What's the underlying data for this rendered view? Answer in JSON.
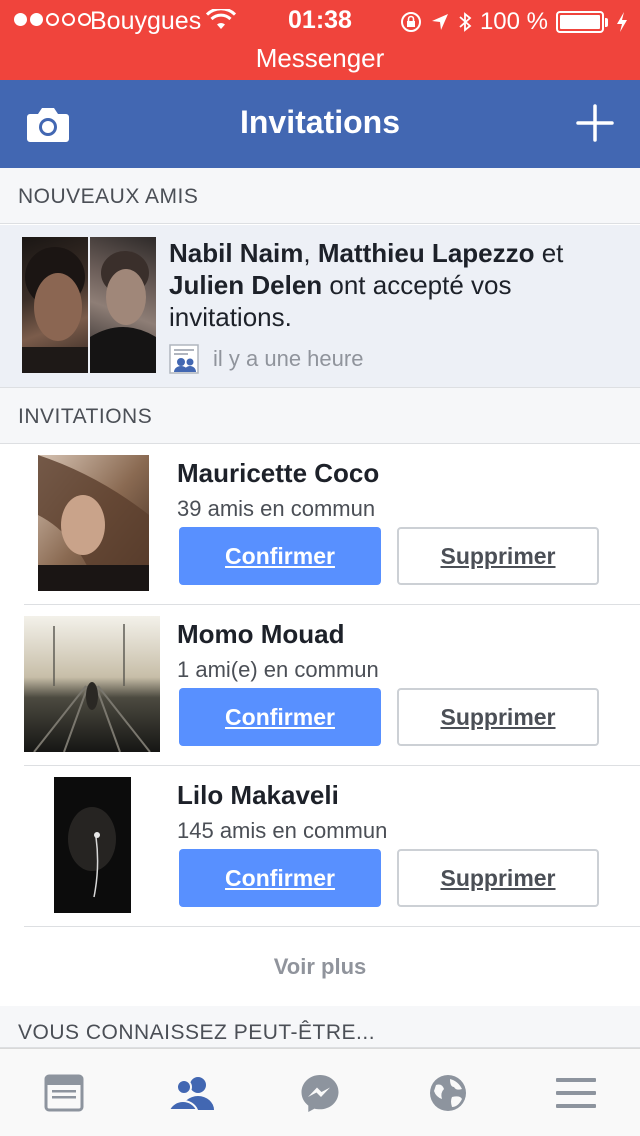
{
  "status_bar": {
    "carrier": "Bouygues",
    "time": "01:38",
    "battery": "100 %",
    "return_app": "Messenger"
  },
  "nav": {
    "title": "Invitations",
    "left_icon": "camera-icon",
    "right_icon": "plus-icon"
  },
  "sections": {
    "new_friends_header": "NOUVEAUX AMIS",
    "invitations_header": "INVITATIONS",
    "suggestions_header": "VOUS CONNAISSEZ PEUT-ÊTRE..."
  },
  "new_friends": {
    "name1": "Nabil Naim",
    "sep1": ", ",
    "name2": "Matthieu Lapezzo",
    "sep2": " et ",
    "name3": "Julien Delen",
    "message": " ont accepté vos invitations.",
    "time": "il y a une heure",
    "icon": "friend-request-icon"
  },
  "invitations": [
    {
      "name": "Mauricette Coco",
      "mutual": "39 amis en commun",
      "confirm": "Confirmer",
      "delete": "Supprimer"
    },
    {
      "name": "Momo Mouad",
      "mutual": "1 ami(e) en commun",
      "confirm": "Confirmer",
      "delete": "Supprimer"
    },
    {
      "name": "Lilo Makaveli",
      "mutual": "145 amis en commun",
      "confirm": "Confirmer",
      "delete": "Supprimer"
    }
  ],
  "voir_plus": "Voir plus",
  "tab_bar": {
    "tabs": [
      "news-feed-icon",
      "friends-icon",
      "messenger-icon",
      "globe-icon",
      "menu-icon"
    ],
    "active": "friends-icon"
  },
  "colors": {
    "status_bar": "#f0443c",
    "nav_bar": "#4267b2",
    "confirm_button": "#5890ff",
    "active_tab": "#4267b2",
    "inactive_tab": "#8d949e"
  }
}
